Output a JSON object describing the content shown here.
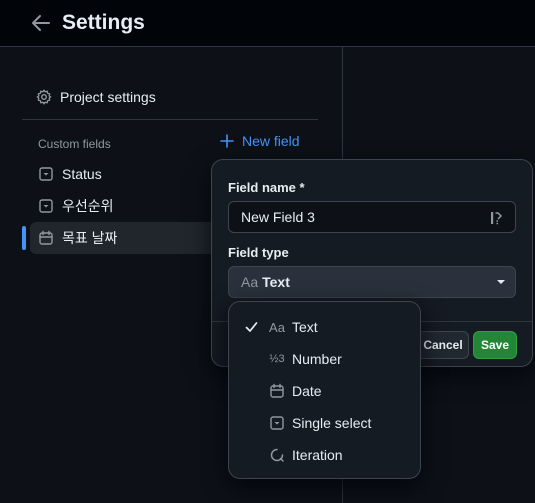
{
  "header": {
    "title": "Settings"
  },
  "sidebar": {
    "project_settings_label": "Project settings",
    "custom_fields_heading": "Custom fields",
    "new_field_label": "New field",
    "fields": [
      {
        "label": "Status",
        "icon": "single-select-icon"
      },
      {
        "label": "우선순위",
        "icon": "single-select-icon"
      },
      {
        "label": "목표 날짜",
        "icon": "calendar-icon",
        "selected": true
      }
    ]
  },
  "dialog": {
    "field_name_label": "Field name *",
    "field_name_value": "New Field 3",
    "field_type_label": "Field type",
    "field_type_icon_text": "Aa",
    "field_type_value": "Text",
    "cancel_label": "Cancel",
    "save_label": "Save"
  },
  "type_menu": {
    "items": [
      {
        "label": "Text",
        "icon": "text-icon",
        "icon_text": "Aa",
        "checked": true
      },
      {
        "label": "Number",
        "icon": "number-icon",
        "icon_text": "½3"
      },
      {
        "label": "Date",
        "icon": "calendar-icon"
      },
      {
        "label": "Single select",
        "icon": "single-select-icon"
      },
      {
        "label": "Iteration",
        "icon": "iteration-icon"
      }
    ]
  },
  "colors": {
    "accent": "#4493f8",
    "primary_button": "#238636",
    "background": "#0d1117",
    "surface": "#151b23"
  }
}
